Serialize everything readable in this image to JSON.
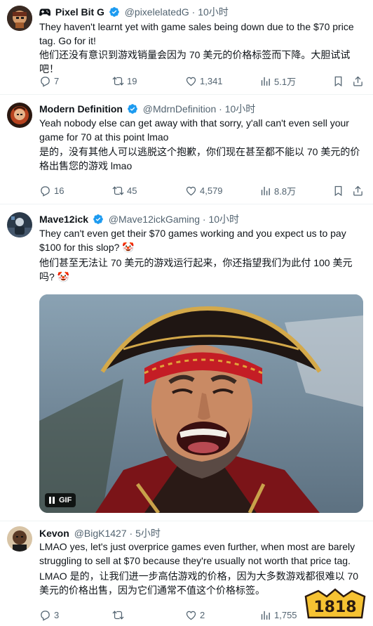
{
  "tweets": [
    {
      "name": "Pixel Bit G",
      "name_prefix_icon": "gamepad-icon",
      "handle": "@pixelelatedG",
      "time": "10小时",
      "text_en": "They haven't learnt yet with game sales being down due to the $70 price tag.  Go for it!",
      "text_zh": "他们还没有意识到游戏销量会因为 70 美元的价格标签而下降。大胆试试吧！",
      "replies": "7",
      "retweets": "19",
      "likes": "1,341",
      "views": "5.1万"
    },
    {
      "name": "Modern Definition",
      "handle": "@MdrnDefinition",
      "time": "10小时",
      "text_en": "Yeah nobody else can get away with that sorry, y'all can't even sell your game for 70 at this point lmao",
      "text_zh": "是的，没有其他人可以逃脱这个抱歉，你们现在甚至都不能以 70 美元的价格出售您的游戏 lmao",
      "replies": "16",
      "retweets": "45",
      "likes": "4,579",
      "views": "8.8万"
    },
    {
      "name": "Mave12ick",
      "handle": "@Mave12ickGaming",
      "time": "10小时",
      "text_en": "They can't even get their $70 games working and you expect us to pay $100 for this slop? 🤡",
      "text_zh": "他们甚至无法让 70 美元的游戏运行起来，你还指望我们为此付 100 美元吗? 🤡",
      "media_badge": "GIF"
    },
    {
      "name": "Kevon",
      "handle": "@BigK1427",
      "time": "5小时",
      "text_en": "LMAO yes, let's just overprice games even further, when most are barely struggling to sell at $70 because they're usually not worth that price tag.",
      "text_zh": "LMAO 是的，让我们进一步高估游戏的价格，因为大多数游戏都很难以 70 美元的价格出售，因为它们通常不值这个价格标签。",
      "replies": "3",
      "retweets": "",
      "likes": "2",
      "views": "1,755"
    }
  ],
  "colors": {
    "verified": "#1d9bf0",
    "muted": "#536471",
    "divider": "#eff3f4"
  },
  "watermark": "1818"
}
